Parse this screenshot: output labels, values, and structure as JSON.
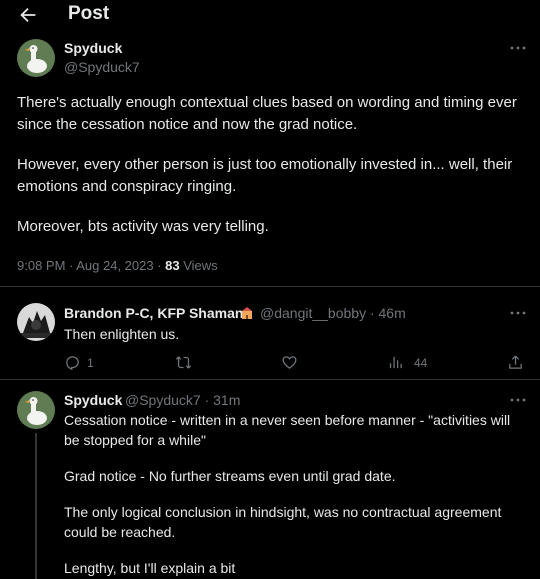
{
  "header": {
    "title": "Post"
  },
  "post": {
    "author_name": "Spyduck",
    "author_handle": "@Spyduck7",
    "paragraphs": [
      "There's actually enough contextual clues based on wording and timing ever since the cessation notice and now the grad notice.",
      "However, every other person is just too emotionally invested in... well, their emotions and conspiracy ringing.",
      "Moreover, bts activity was very telling."
    ],
    "timestamp": "9:08 PM · Aug 24, 2023 · ",
    "views_count": "83",
    "views_label": " Views"
  },
  "reply1": {
    "author_name": "Brandon P-C, KFP Shaman",
    "author_handle": "@dangit__bobby · 46m",
    "text": "Then enlighten us.",
    "reply_count": "1",
    "views_count": "44"
  },
  "reply2": {
    "author_name": "Spyduck",
    "author_handle": "@Spyduck7 · 31m",
    "paragraphs": [
      "Cessation notice - written in a never seen before manner - \"activities will be stopped for a while\"",
      "Grad notice - No further streams even until grad date.",
      "The only logical conclusion in hindsight, was no contractual agreement could be reached.",
      "Lengthy, but I'll explain a bit"
    ]
  },
  "colors": {
    "background": "#000000",
    "text": "#e7e9ea",
    "muted": "#71767b",
    "divider": "#2f3336"
  }
}
